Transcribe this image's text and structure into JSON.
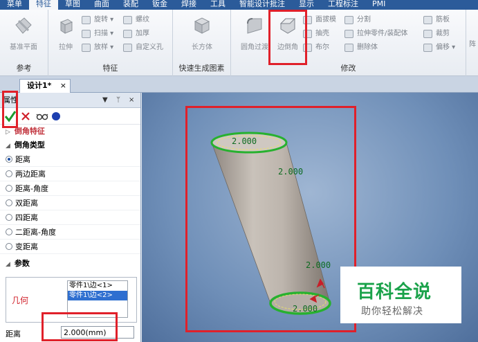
{
  "menu": {
    "items": [
      "菜单",
      "特征",
      "草图",
      "曲面",
      "装配",
      "钣金",
      "焊接",
      "工具",
      "智能设计批注",
      "显示",
      "工程标注",
      "PMI"
    ],
    "active_index": 1
  },
  "ribbon": {
    "groups": {
      "reference": {
        "title": "参考",
        "plane_label": "基准平面"
      },
      "feature": {
        "title": "特征",
        "extrude_label": "拉伸",
        "revolve_label": "旋转",
        "sweep_label": "扫描",
        "loft_label": "放样",
        "thread_label": "螺纹",
        "thicken_label": "加厚",
        "custom_hole_label": "自定义孔"
      },
      "quick": {
        "title": "快速生成图素",
        "box_label": "长方体"
      },
      "modify": {
        "title": "修改",
        "fillet_label": "圆角过渡",
        "chamfer_label": "边倒角",
        "draft_label": "面拔模",
        "shell_label": "抽壳",
        "boolean_label": "布尔",
        "split_label": "分割",
        "extrude_to_part_label": "拉伸零件/装配体",
        "delete_body_label": "删除体",
        "rib_label": "筋板",
        "trim_label": "裁剪",
        "offset_label": "偏移",
        "array_label": "阵"
      }
    }
  },
  "document": {
    "tab_label": "设计1*",
    "close_label": "×"
  },
  "panel": {
    "title": "属性",
    "pin_label": "ᛘ",
    "close_label": "×",
    "menu_label": "▼",
    "confirm_icon": "check-icon",
    "cancel_icon": "cross-icon",
    "preview_icon": "glasses-icon",
    "section_chamfer_feature": "倒角特征",
    "section_chamfer_type": "倒角类型",
    "types": [
      "距离",
      "两边距离",
      "距离-角度",
      "双距离",
      "四距离",
      "二距离-角度",
      "变距离"
    ],
    "selected_type_index": 0,
    "section_params": "参数",
    "geometry_label": "几何",
    "geometry_items": [
      "零件1\\边<1>",
      "零件1\\边<2>"
    ],
    "selected_geometry_index": 1,
    "distance_label": "距离",
    "distance_value": "2.000(mm)"
  },
  "viewport": {
    "dim_labels": [
      "2.000",
      "2.000",
      "2.000",
      "2.000"
    ]
  },
  "watermark": {
    "title": "百科全说",
    "subtitle": "助你轻松解决"
  },
  "colors": {
    "menubar": "#2b5b9a",
    "highlight_frame": "#e0202a",
    "edge_selection": "#27b12f",
    "dimension_text": "#0d6b20"
  }
}
